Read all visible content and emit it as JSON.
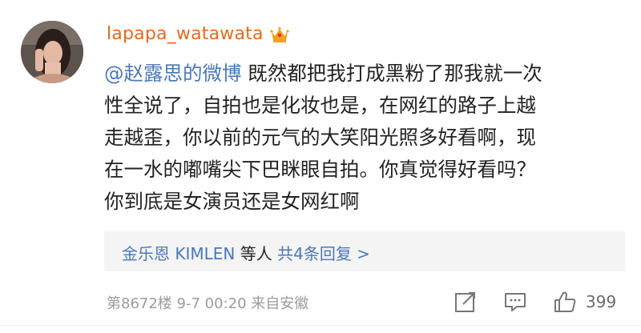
{
  "comment": {
    "username": "lapapa_watawata",
    "mention": "@赵露思的微博",
    "lines": [
      " 既然都把我打成黑粉了那我就一次",
      "性全说了，自拍也是化妆也是，在网红的路子上越",
      "走越歪，你以前的元气的大笑阳光照多好看啊，现",
      "在一水的嘟嘴尖下巴眯眼自拍。你真觉得好看吗？",
      "你到底是女演员还是女网红啊"
    ],
    "replies": {
      "names": "金乐恩 KIMLEN",
      "others": " 等人 ",
      "link": "共4条回复 >"
    },
    "meta": "第8672楼 9-7 00:20 来自安徽",
    "like_count": "399"
  },
  "colors": {
    "username": "#e36a1e",
    "link": "#4a78b8",
    "meta": "#9b9b9b",
    "reply_bg": "#f4f4f4"
  },
  "icons": [
    "avatar-photo",
    "crown-icon",
    "share-icon",
    "comment-icon",
    "like-icon"
  ]
}
